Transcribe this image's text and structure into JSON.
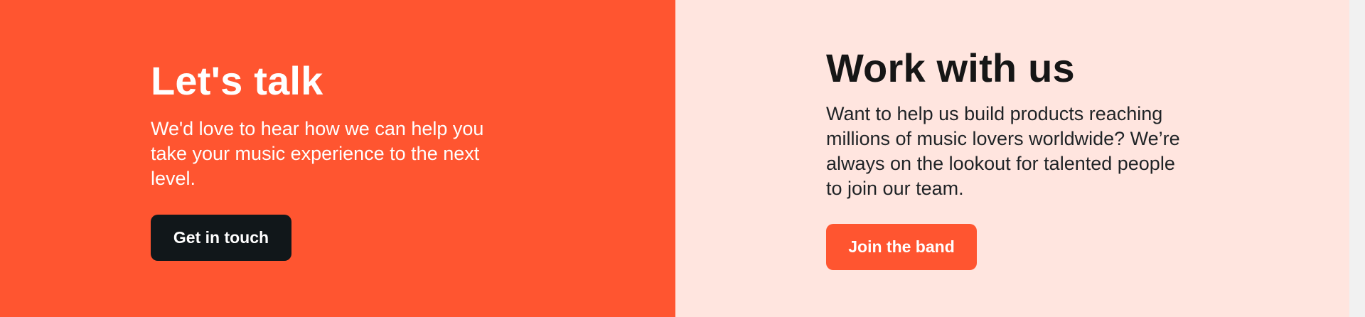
{
  "colors": {
    "left_background": "#FF5530",
    "right_background": "#FFE5DF",
    "dark_button": "#11171A",
    "accent_button": "#FF5530"
  },
  "left_panel": {
    "title": "Let's talk",
    "description": "We'd love to hear how we can help you take your music experience to the next level.",
    "button_label": "Get in touch"
  },
  "right_panel": {
    "title": "Work with us",
    "description": "Want to help us build products reaching millions of music lovers worldwide? We’re always on the lookout for talented people to join our team.",
    "button_label": "Join the band"
  }
}
